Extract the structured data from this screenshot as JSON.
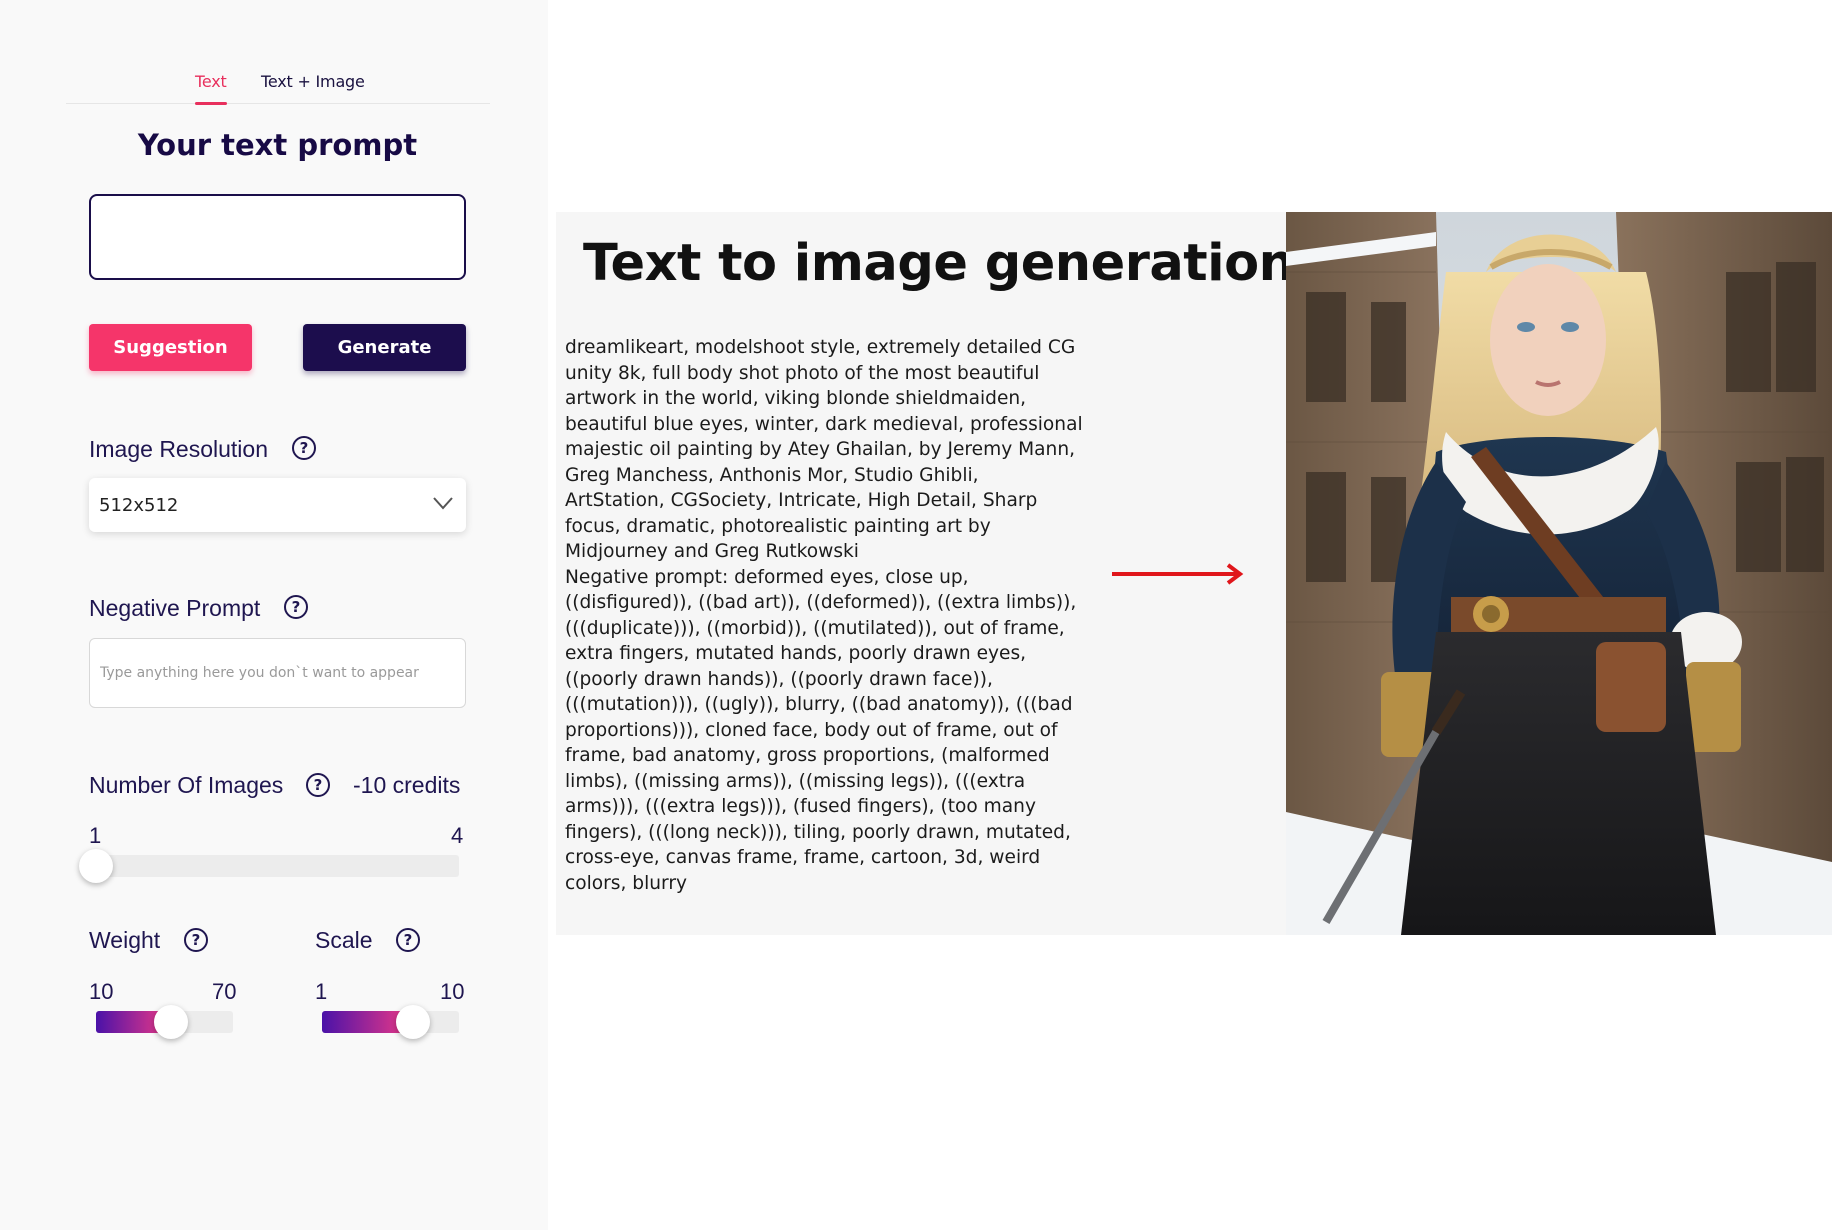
{
  "tabs": [
    {
      "label": "Text",
      "active": true
    },
    {
      "label": "Text + Image",
      "active": false
    }
  ],
  "prompt": {
    "title": "Your text prompt",
    "value": "",
    "suggestion_label": "Suggestion",
    "generate_label": "Generate"
  },
  "resolution": {
    "label": "Image Resolution",
    "help_icon": "question-circle-icon",
    "selected": "512x512"
  },
  "negative": {
    "label": "Negative Prompt",
    "placeholder": "Type anything here you don`t want to appear"
  },
  "images": {
    "label": "Number Of Images",
    "credits": "-10 credits",
    "min": "1",
    "max": "4",
    "value": 1
  },
  "weight": {
    "label": "Weight",
    "min": "10",
    "max": "70",
    "value": 43
  },
  "scale": {
    "label": "Scale",
    "min": "1",
    "max": "10",
    "value": 7
  },
  "content": {
    "heading": "Text to image generation",
    "prompt_text": "dreamlikeart, modelshoot style, extremely detailed CG unity 8k, full body shot photo of the most beautiful artwork in the world, viking blonde shieldmaiden, beautiful blue eyes, winter, dark medieval, professional majestic oil painting by Atey Ghailan, by Jeremy Mann, Greg Manchess, Anthonis Mor, Studio Ghibli, ArtStation, CGSociety, Intricate, High Detail, Sharp focus, dramatic, photorealistic painting art by Midjourney and Greg Rutkowski",
    "negative_text": "Negative prompt: deformed eyes, close up, ((disfigured)), ((bad art)), ((deformed)), ((extra limbs)), (((duplicate))), ((morbid)), ((mutilated)), out of frame, extra fingers, mutated hands, poorly drawn eyes, ((poorly drawn hands)), ((poorly drawn face)), (((mutation))), ((ugly)), blurry, ((bad anatomy)), (((bad proportions))), cloned face, body out of frame, out of frame, bad anatomy, gross proportions, (malformed limbs), ((missing arms)), ((missing legs)), (((extra arms))), (((extra legs))), (fused fingers), (too many fingers), (((long neck))), tiling, poorly drawn, mutated, cross-eye, canvas frame, frame, cartoon, 3d, weird colors, blurry",
    "arrow_icon": "arrow-right-icon",
    "arrow_color": "#e0161b"
  },
  "colors": {
    "accent": "#f5356a",
    "primary": "#1c0d4d"
  }
}
